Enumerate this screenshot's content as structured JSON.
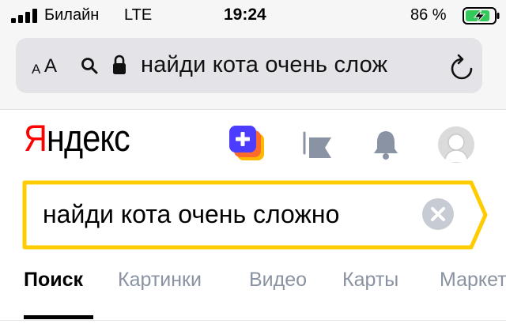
{
  "status_bar": {
    "carrier": "Билайн",
    "network": "LTE",
    "time": "19:24",
    "battery_percent": "86 %",
    "battery_level": 0.86,
    "battery_charging": true,
    "signal_bars": 4
  },
  "address_bar": {
    "text_size_small": "A",
    "text_size_large": "A",
    "url_text": "найди кота очень слож"
  },
  "header": {
    "logo_first_letter": "Я",
    "logo_rest": "ндекс",
    "plus_color": "#4c3cff",
    "plus_accent": "#ffb800"
  },
  "search": {
    "query": "найди кота очень сложно",
    "frame_color": "#ffcc00"
  },
  "tabs": [
    {
      "label": "Поиск",
      "active": true
    },
    {
      "label": "Картинки",
      "active": false
    },
    {
      "label": "Видео",
      "active": false
    },
    {
      "label": "Карты",
      "active": false
    },
    {
      "label": "Маркет",
      "active": false
    }
  ],
  "colors": {
    "logo_red": "#ff0000",
    "icon_gray": "#8a93a3",
    "battery_green": "#34c759"
  }
}
